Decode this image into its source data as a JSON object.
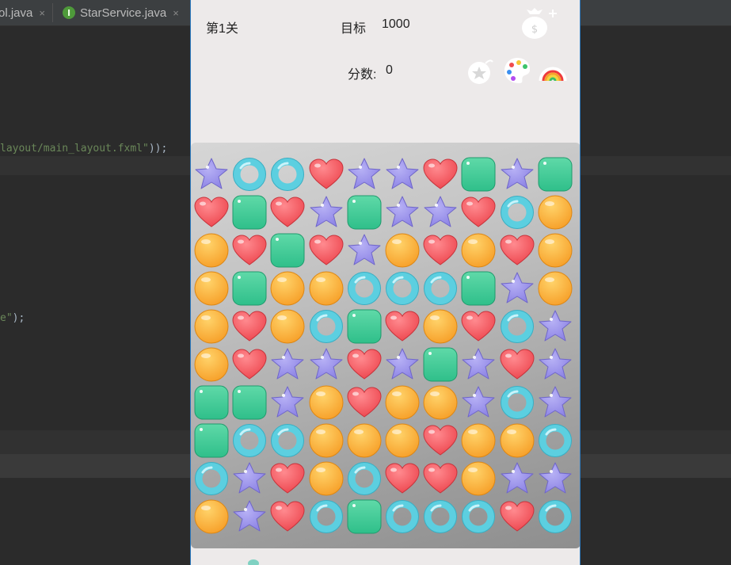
{
  "ide": {
    "tabs": [
      {
        "label": "ol.java",
        "close": "×"
      },
      {
        "label": "StarService.java",
        "icon": "I",
        "close": "×"
      }
    ],
    "code_lines": [
      {
        "string": "layout/main_layout.fxml\"",
        "tail": "));"
      },
      {
        "string": "e\"",
        "tail": ");"
      }
    ]
  },
  "game": {
    "level_label": "第1关",
    "target_label": "目标",
    "target_value": "1000",
    "score_label": "分数:",
    "score_value": "0",
    "tools": [
      "money-bag-plus-icon",
      "star-bomb-icon",
      "color-palette-icon",
      "rainbow-icon"
    ],
    "board": [
      [
        "star",
        "ring",
        "ring",
        "heart",
        "star",
        "star",
        "heart",
        "square",
        "star",
        "square"
      ],
      [
        "heart",
        "square",
        "heart",
        "star",
        "square",
        "star",
        "star",
        "heart",
        "ring",
        "orb"
      ],
      [
        "orb",
        "heart",
        "square",
        "heart",
        "star",
        "orb",
        "heart",
        "orb",
        "heart",
        "orb"
      ],
      [
        "orb",
        "square",
        "orb",
        "orb",
        "ring",
        "ring",
        "ring",
        "square",
        "star",
        "orb"
      ],
      [
        "orb",
        "heart",
        "orb",
        "ring",
        "square",
        "heart",
        "orb",
        "heart",
        "ring",
        "star"
      ],
      [
        "orb",
        "heart",
        "star",
        "star",
        "heart",
        "star",
        "square",
        "star",
        "heart",
        "star"
      ],
      [
        "square",
        "square",
        "star",
        "orb",
        "heart",
        "orb",
        "orb",
        "star",
        "ring",
        "star"
      ],
      [
        "square",
        "ring",
        "ring",
        "orb",
        "orb",
        "orb",
        "heart",
        "orb",
        "orb",
        "ring"
      ],
      [
        "ring",
        "star",
        "heart",
        "orb",
        "ring",
        "heart",
        "heart",
        "orb",
        "star",
        "star"
      ],
      [
        "orb",
        "star",
        "heart",
        "ring",
        "square",
        "ring",
        "ring",
        "ring",
        "heart",
        "ring"
      ]
    ],
    "colors": {
      "star": "#8f86e6",
      "ring": "#5ccfe0",
      "heart": "#ee4a52",
      "square": "#2fbf8a",
      "orb": "#f7a22c"
    }
  }
}
